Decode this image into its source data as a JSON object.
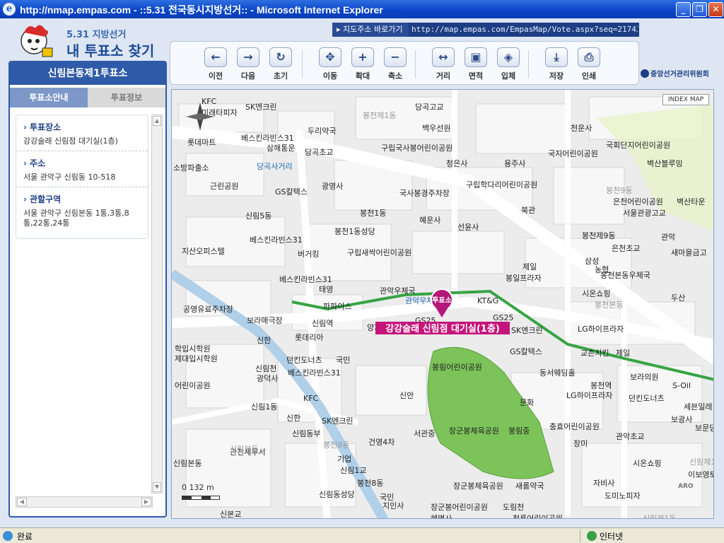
{
  "window": {
    "title": "http://nmap.empas.com - ::5.31 전국동시지방선거:: - Microsoft Internet Explorer",
    "min": "_",
    "max": "❐",
    "close": "✕"
  },
  "logo": {
    "sub": "5.31 지방선거",
    "main": "내 투표소 찾기"
  },
  "address": {
    "button": "지도주소 바로가기",
    "url": "http://map.empas.com/EmpasMap/Vote.aspx?seq=21743"
  },
  "toolbar": [
    {
      "label": "이전",
      "icon": "arrow-left-icon",
      "glyph": "←"
    },
    {
      "label": "다음",
      "icon": "arrow-right-icon",
      "glyph": "→"
    },
    {
      "label": "초기",
      "icon": "refresh-icon",
      "glyph": "↻"
    },
    {
      "label": "이동",
      "icon": "move-icon",
      "glyph": "✥"
    },
    {
      "label": "확대",
      "icon": "zoom-in-icon",
      "glyph": "+"
    },
    {
      "label": "축소",
      "icon": "zoom-out-icon",
      "glyph": "−"
    },
    {
      "label": "거리",
      "icon": "distance-icon",
      "glyph": "↔"
    },
    {
      "label": "면적",
      "icon": "area-icon",
      "glyph": "▣"
    },
    {
      "label": "입체",
      "icon": "3d-icon",
      "glyph": "◈"
    },
    {
      "label": "저장",
      "icon": "save-icon",
      "glyph": "⤓"
    },
    {
      "label": "인쇄",
      "icon": "print-icon",
      "glyph": "⎙"
    }
  ],
  "nec": "중앙선거관리위원회",
  "panel": {
    "header": "신림본동제1투표소",
    "tabs": [
      "투표소안내",
      "투표정보"
    ],
    "info": [
      {
        "title": "투표장소",
        "value": "강강술래 신림점 대기실(1층)"
      },
      {
        "title": "주소",
        "value": "서울 관악구 신림동 10-518"
      },
      {
        "title": "관할구역",
        "value": "서울 관악구 신림본동 1통,3통,8통,22통,24통"
      }
    ]
  },
  "map": {
    "index_map": "INDEX MAP",
    "scale": "0  132 m",
    "marker_label": "투표소",
    "marker_caption": "강강술래 신림점 대기실(1층)",
    "aro": "ARO",
    "labels": [
      {
        "t": "KFC",
        "c": "poi"
      },
      {
        "t": "SK엔크린",
        "c": "poi"
      },
      {
        "t": "미래타피자",
        "c": "poi"
      },
      {
        "t": "당곡고교",
        "c": "poi"
      },
      {
        "t": "봉천제1동",
        "c": "gray"
      },
      {
        "t": "백우선원",
        "c": "poi"
      },
      {
        "t": "천운사",
        "c": "poi"
      },
      {
        "t": "두리약국",
        "c": "poi"
      },
      {
        "t": "국회단지어린이공원",
        "c": "poi"
      },
      {
        "t": "베스킨라빈스31",
        "c": "poi"
      },
      {
        "t": "삼해통운",
        "c": "poi"
      },
      {
        "t": "롯데마트",
        "c": "poi"
      },
      {
        "t": "당곡초교",
        "c": "poi"
      },
      {
        "t": "구립국사봉어린이공원",
        "c": "poi"
      },
      {
        "t": "국지어린이공원",
        "c": "poi"
      },
      {
        "t": "벽산블루밍",
        "c": "poi"
      },
      {
        "t": "청은사",
        "c": "poi"
      },
      {
        "t": "용주사",
        "c": "poi"
      },
      {
        "t": "소방파출소",
        "c": "poi"
      },
      {
        "t": "당곡사거리",
        "c": "road"
      },
      {
        "t": "근린공원",
        "c": "poi"
      },
      {
        "t": "광영사",
        "c": "poi"
      },
      {
        "t": "구립학다리어린이공원",
        "c": "poi"
      },
      {
        "t": "봉천9동",
        "c": "gray"
      },
      {
        "t": "GS칼텍스",
        "c": "poi"
      },
      {
        "t": "국사봉경주차장",
        "c": "poi"
      },
      {
        "t": "은천어린이공원",
        "c": "poi"
      },
      {
        "t": "벽산타운",
        "c": "poi"
      },
      {
        "t": "북관",
        "c": "poi"
      },
      {
        "t": "서울관광고교",
        "c": "poi"
      },
      {
        "t": "신림5동",
        "c": "poi"
      },
      {
        "t": "봉천1동",
        "c": "poi"
      },
      {
        "t": "혜운사",
        "c": "poi"
      },
      {
        "t": "선윤사",
        "c": "poi"
      },
      {
        "t": "봉천1동성당",
        "c": "poi"
      },
      {
        "t": "베스킨라빈스31",
        "c": "poi"
      },
      {
        "t": "봉천제9동",
        "c": "poi"
      },
      {
        "t": "관악",
        "c": "poi"
      },
      {
        "t": "지산오피스텔",
        "c": "poi"
      },
      {
        "t": "버거킹",
        "c": "poi"
      },
      {
        "t": "구립새싹어린이공원",
        "c": "poi"
      },
      {
        "t": "은천초교",
        "c": "poi"
      },
      {
        "t": "새마을금고",
        "c": "poi"
      },
      {
        "t": "제일",
        "c": "poi"
      },
      {
        "t": "삼성",
        "c": "poi"
      },
      {
        "t": "농협",
        "c": "poi"
      },
      {
        "t": "봉일프라자",
        "c": "poi"
      },
      {
        "t": "봉천본동우체국",
        "c": "poi"
      },
      {
        "t": "베스킨라빈스31",
        "c": "poi"
      },
      {
        "t": "태영",
        "c": "poi"
      },
      {
        "t": "관악우체국",
        "c": "poi"
      },
      {
        "t": "시온쇼핑",
        "c": "poi"
      },
      {
        "t": "두산",
        "c": "poi"
      },
      {
        "t": "공영유료주차장",
        "c": "poi"
      },
      {
        "t": "파파이스",
        "c": "poi"
      },
      {
        "t": "관악우체국",
        "c": "road"
      },
      {
        "t": "KT&G",
        "c": "poi"
      },
      {
        "t": "봉천본동",
        "c": "gray"
      },
      {
        "t": "보라매극장",
        "c": "poi"
      },
      {
        "t": "신림역",
        "c": "poi"
      },
      {
        "t": "양지병원",
        "c": "poi"
      },
      {
        "t": "GS25",
        "c": "poi"
      },
      {
        "t": "GS25",
        "c": "poi"
      },
      {
        "t": "LG하이프라자",
        "c": "poi"
      },
      {
        "t": "신한",
        "c": "poi"
      },
      {
        "t": "롯데리아",
        "c": "poi"
      },
      {
        "t": "SK엔크린",
        "c": "poi"
      },
      {
        "t": "교촌치킨",
        "c": "poi"
      },
      {
        "t": "학입시학원",
        "c": "poi"
      },
      {
        "t": "제대입시학원",
        "c": "poi"
      },
      {
        "t": "던킨도너츠",
        "c": "poi"
      },
      {
        "t": "국민",
        "c": "poi"
      },
      {
        "t": "GS칼텍스",
        "c": "poi"
      },
      {
        "t": "제일",
        "c": "poi"
      },
      {
        "t": "신림천",
        "c": "poi"
      },
      {
        "t": "베스킨라빈스31",
        "c": "poi"
      },
      {
        "t": "봉림어린이공원",
        "c": "poi"
      },
      {
        "t": "동서웨딩홀",
        "c": "poi"
      },
      {
        "t": "보라의원",
        "c": "poi"
      },
      {
        "t": "광덕사",
        "c": "poi"
      },
      {
        "t": "S-Oil",
        "c": "poi"
      },
      {
        "t": "어린이공원",
        "c": "poi"
      },
      {
        "t": "봉천역",
        "c": "poi"
      },
      {
        "t": "신안",
        "c": "poi"
      },
      {
        "t": "LG하이프라자",
        "c": "poi"
      },
      {
        "t": "던킨도너츠",
        "c": "poi"
      },
      {
        "t": "KFC",
        "c": "poi"
      },
      {
        "t": "문화",
        "c": "poi"
      },
      {
        "t": "세븐일레",
        "c": "poi"
      },
      {
        "t": "신림1동",
        "c": "poi"
      },
      {
        "t": "보광사",
        "c": "poi"
      },
      {
        "t": "신한",
        "c": "poi"
      },
      {
        "t": "SK엔크린",
        "c": "poi"
      },
      {
        "t": "장군봉체육공원",
        "c": "poi"
      },
      {
        "t": "봉림중",
        "c": "poi"
      },
      {
        "t": "충효어린이공원",
        "c": "poi"
      },
      {
        "t": "보문당",
        "c": "poi"
      },
      {
        "t": "신림동부",
        "c": "poi"
      },
      {
        "t": "서관중",
        "c": "poi"
      },
      {
        "t": "관악초교",
        "c": "poi"
      },
      {
        "t": "건영4차",
        "c": "poi"
      },
      {
        "t": "봉천8동",
        "c": "gray"
      },
      {
        "t": "장미",
        "c": "poi"
      },
      {
        "t": "신림제1동",
        "c": "gray"
      },
      {
        "t": "관천세무서",
        "c": "poi"
      },
      {
        "t": "신림본동",
        "c": "poi"
      },
      {
        "t": "기업",
        "c": "poi"
      },
      {
        "t": "시온쇼핑",
        "c": "poi"
      },
      {
        "t": "이보영토킹클럽",
        "c": "poi"
      },
      {
        "t": "신림1교",
        "c": "poi"
      },
      {
        "t": "봉천8동",
        "c": "poi"
      },
      {
        "t": "자비사",
        "c": "poi"
      },
      {
        "t": "장군봉체육공원",
        "c": "poi"
      },
      {
        "t": "새롬약국",
        "c": "poi"
      },
      {
        "t": "신림동성당",
        "c": "poi"
      },
      {
        "t": "국민",
        "c": "poi"
      },
      {
        "t": "도미노피자",
        "c": "poi"
      },
      {
        "t": "장군봉어린이공원",
        "c": "poi"
      },
      {
        "t": "도림천",
        "c": "poi"
      },
      {
        "t": "지인사",
        "c": "poi"
      },
      {
        "t": "신본교",
        "c": "poi"
      },
      {
        "t": "혜명사",
        "c": "poi"
      },
      {
        "t": "청룡어린이공원",
        "c": "poi"
      },
      {
        "t": "신림제1동",
        "c": "gray"
      },
      {
        "t": "신림본동",
        "c": "gray"
      }
    ]
  },
  "status": {
    "done": "완료",
    "zone": "인터넷"
  }
}
